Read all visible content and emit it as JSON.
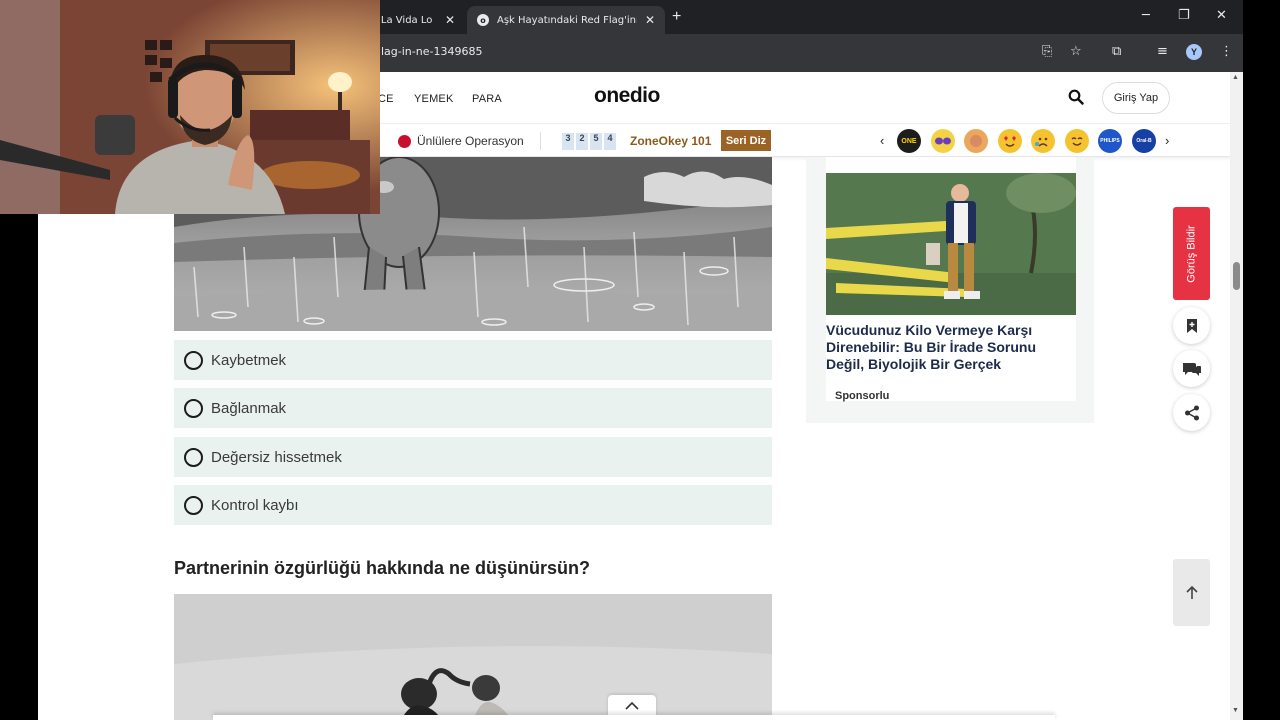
{
  "browser": {
    "tabs": [
      {
        "title": "' La Vida Lo",
        "active": false
      },
      {
        "title": "Aşk Hayatındaki Red Flag'ini Sö",
        "active": true
      }
    ],
    "new_tab_icon": "plus-icon",
    "window_controls": {
      "minimize": "─",
      "restore": "❐",
      "close": "✕"
    },
    "url": "lag-in-ne-1349685",
    "profile_initial": "Y"
  },
  "site": {
    "nav_links": [
      "CE",
      "YEMEK",
      "PARA"
    ],
    "logo": "onedio",
    "login_label": "Giriş Yap",
    "trend": {
      "story_label": "Ünlülere Operasyon",
      "tiles": [
        "3",
        "2",
        "5",
        "4"
      ],
      "zone_label": "ZoneOkey 101",
      "seri_label": "Seri Diz",
      "reactions": [
        {
          "name": "reaction-onedio-icon",
          "label": "ONE",
          "color": "#1d1d1d"
        },
        {
          "name": "reaction-mask-icon",
          "label": "",
          "color": "#f3d246"
        },
        {
          "name": "reaction-clap-icon",
          "label": "",
          "color": "#e9a85c"
        },
        {
          "name": "reaction-heart-eyes-icon",
          "label": "",
          "color": "#f5c330"
        },
        {
          "name": "reaction-sad-icon",
          "label": "",
          "color": "#f5c330"
        },
        {
          "name": "reaction-smile-icon",
          "label": "",
          "color": "#f5c330"
        },
        {
          "name": "reaction-philips-icon",
          "label": "PHILIPS",
          "color": "#1f56c9"
        },
        {
          "name": "reaction-brand-icon",
          "label": "Oral-B",
          "color": "#1640a4"
        }
      ]
    }
  },
  "quiz": {
    "options": [
      "Kaybetmek",
      "Bağlanmak",
      "Değersiz hissetmek",
      "Kontrol kaybı"
    ],
    "next_question": "Partnerinin özgürlüğü hakkında ne düşünürsün?"
  },
  "ad": {
    "title": "Vücudunuz Kilo Vermeye Karşı Direnebilir: Bu Bir İrade Sorunu Değil, Biyolojik Bir Gerçek",
    "sponsor": "Sponsorlu"
  },
  "actions": {
    "feedback_label": "Görüş Bildir"
  },
  "colors": {
    "accent_red": "#e53344",
    "option_bg": "#eaf2ef",
    "seri_bg": "#9b6424"
  }
}
